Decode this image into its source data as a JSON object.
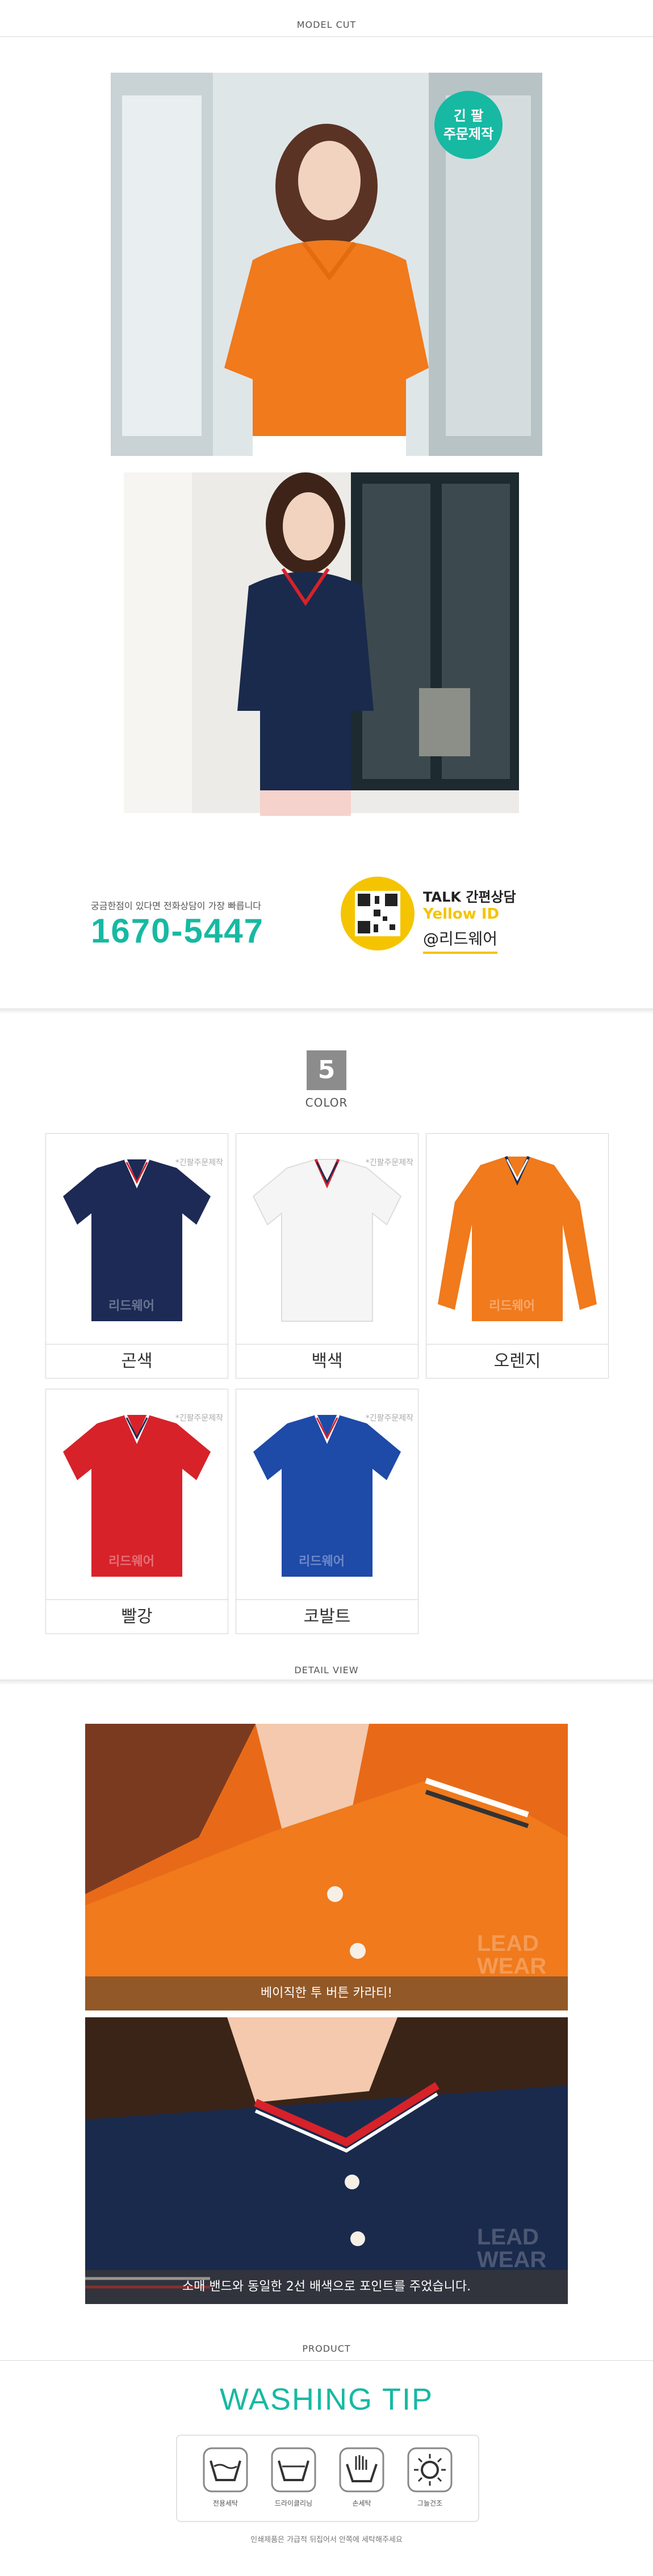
{
  "model_cut": {
    "title": "MODEL CUT"
  },
  "badge": {
    "line1": "긴 팔",
    "line2": "주문제작"
  },
  "contact": {
    "question": "궁금한점이 있다면 전화상담이 가장 빠릅니다",
    "phone": "1670-5447",
    "talk_label": "TALK",
    "consult_label": "간편상담",
    "yellow_id_label": "Yellow ID",
    "id": "@리드웨어"
  },
  "color_section": {
    "count": "5",
    "title": "COLOR"
  },
  "swatches": [
    {
      "label": "곤색",
      "note": "*긴팔주문제작",
      "logo": "리드웨어",
      "color": "#1c2a55"
    },
    {
      "label": "백색",
      "note": "*긴팔주문제작",
      "logo": "",
      "color": "#f5f5f5"
    },
    {
      "label": "오렌지",
      "note": "",
      "logo": "리드웨어",
      "color": "#f07a1c"
    },
    {
      "label": "빨강",
      "note": "*긴팔주문제작",
      "logo": "리드웨어",
      "color": "#d7222a"
    },
    {
      "label": "코발트",
      "note": "*긴팔주문제작",
      "logo": "리드웨어",
      "color": "#1e4aa8"
    }
  ],
  "detail_view": {
    "title": "DETAIL VIEW",
    "captions": [
      "베이직한 투 버튼 카라티!",
      "소매 밴드와 동일한 2선 배색으로 포인트를 주었습니다."
    ],
    "watermark": "LEAD WEAR"
  },
  "product": {
    "title": "PRODUCT"
  },
  "washing": {
    "title": "WASHING TIP",
    "items": [
      {
        "label": "전용세탁",
        "icon": "wash-tub-icon"
      },
      {
        "label": "드라이클리닝",
        "icon": "dry-clean-icon"
      },
      {
        "label": "손세탁",
        "icon": "hand-wash-icon"
      },
      {
        "label": "그늘건조",
        "icon": "shade-dry-icon"
      }
    ],
    "footnote": "인쇄제품은 가급적 뒤집어서 안쪽에 세탁해주세요"
  },
  "colors": {
    "accent": "#17b9a3",
    "kakao_yellow": "#f5c400"
  }
}
